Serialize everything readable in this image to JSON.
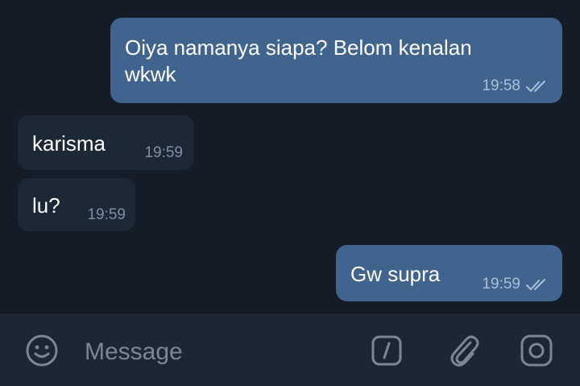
{
  "messages": [
    {
      "direction": "outgoing",
      "text_line1": "Oiya namanya siapa? Belom kenalan",
      "text_line2": "wkwk",
      "time": "19:58",
      "status": "read"
    },
    {
      "direction": "incoming",
      "text": "karisma",
      "time": "19:59"
    },
    {
      "direction": "incoming",
      "text": "lu?",
      "time": "19:59"
    },
    {
      "direction": "outgoing",
      "text": "Gw supra",
      "time": "19:59",
      "status": "read"
    }
  ],
  "composer": {
    "placeholder": "Message",
    "emoji_icon": "smile-icon",
    "command_icon": "slash-command-icon",
    "attach_icon": "paperclip-icon",
    "camera_icon": "camera-icon"
  },
  "colors": {
    "background": "#141c28",
    "outgoing_bubble": "#40648e",
    "incoming_bubble": "#1d2837",
    "composer_bar": "#1d2734",
    "icon": "#7a8796"
  }
}
